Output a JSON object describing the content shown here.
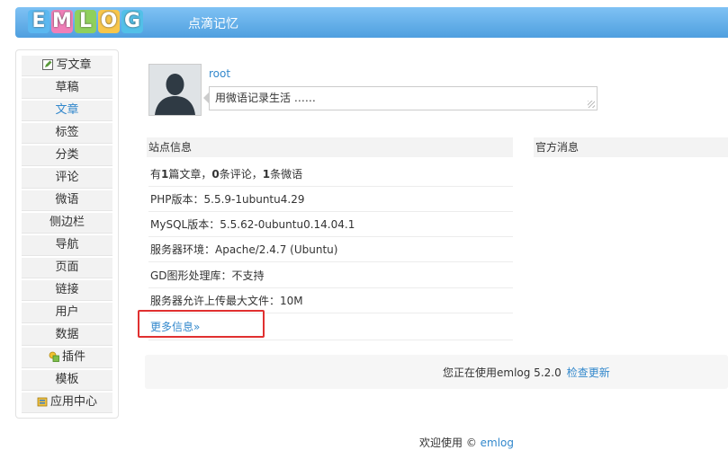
{
  "header": {
    "logo_letters": [
      "E",
      "M",
      "L",
      "O",
      "G"
    ],
    "site_name": "点滴记忆"
  },
  "sidebar": {
    "items": [
      {
        "label": "写文章",
        "icon": "edit-icon",
        "active": false
      },
      {
        "label": "草稿",
        "active": false
      },
      {
        "label": "文章",
        "active": true
      },
      {
        "label": "标签",
        "active": false
      },
      {
        "label": "分类",
        "active": false
      },
      {
        "label": "评论",
        "active": false
      },
      {
        "label": "微语",
        "active": false
      },
      {
        "label": "侧边栏",
        "active": false
      },
      {
        "label": "导航",
        "active": false
      },
      {
        "label": "页面",
        "active": false
      },
      {
        "label": "链接",
        "active": false
      },
      {
        "label": "用户",
        "active": false
      },
      {
        "label": "数据",
        "active": false
      },
      {
        "label": "插件",
        "icon": "plugin-icon",
        "active": false
      },
      {
        "label": "模板",
        "active": false
      },
      {
        "label": "应用中心",
        "icon": "app-center-icon",
        "active": false
      }
    ]
  },
  "profile": {
    "username": "root",
    "twitter_placeholder": "用微语记录生活 ……"
  },
  "site_info": {
    "title": "站点信息",
    "stats": {
      "p1": "有",
      "n1": "1",
      "p2": "篇文章，",
      "n2": "0",
      "p3": "条评论，",
      "n3": "1",
      "p4": "条微语"
    },
    "php": "PHP版本：5.5.9-1ubuntu4.29",
    "mysql": "MySQL版本：5.5.62-0ubuntu0.14.04.1",
    "server": "服务器环境：Apache/2.4.7 (Ubuntu)",
    "gd": "GD图形处理库：不支持",
    "upload": "服务器允许上传最大文件：10M",
    "more": "更多信息»"
  },
  "official": {
    "title": "官方消息"
  },
  "version": {
    "text": "您正在使用emlog 5.2.0",
    "check": "检查更新"
  },
  "footer": {
    "text": "欢迎使用 © ",
    "link": "emlog"
  },
  "colors": {
    "accent": "#3388cc",
    "header_top": "#7fc2f4",
    "header_bottom": "#4f9fdf",
    "highlight_border": "#e03030"
  }
}
